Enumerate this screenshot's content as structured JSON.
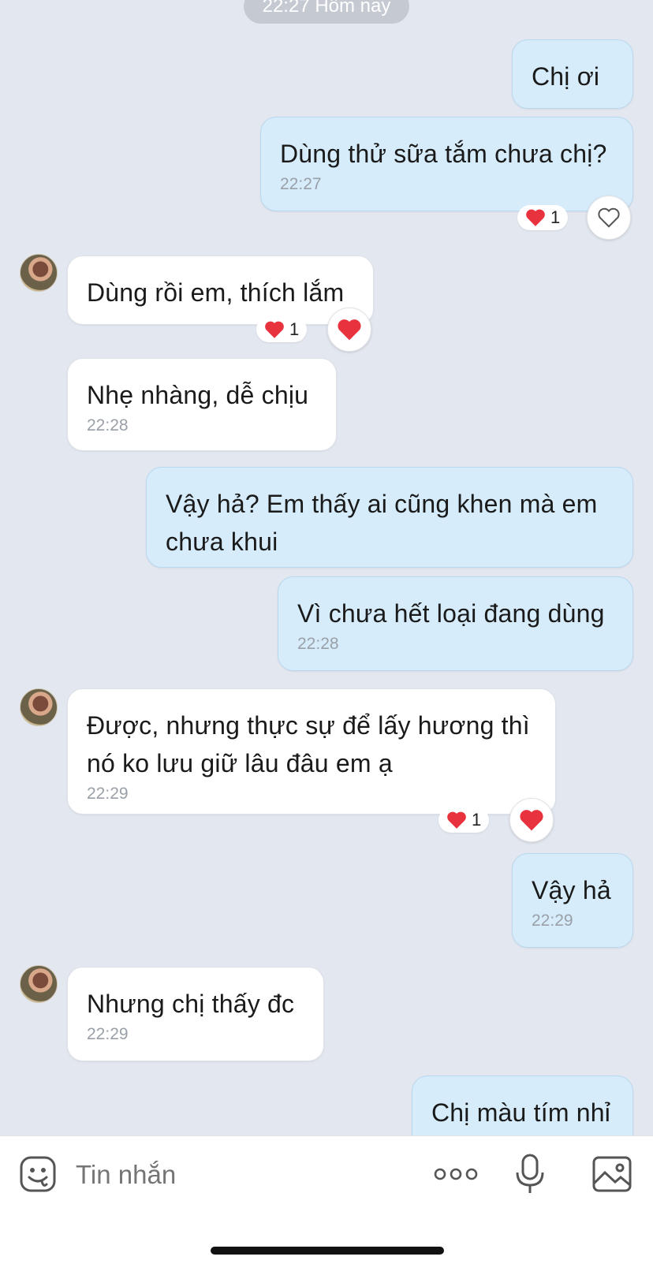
{
  "date_header": "22:27 Hôm nay",
  "messages": [
    {
      "dir": "out",
      "text": "Chị ơi",
      "time": ""
    },
    {
      "dir": "out",
      "text": "Dùng thử sữa tắm chưa chị?",
      "time": "22:27",
      "reaction_count": "1"
    },
    {
      "dir": "in",
      "text": "Dùng rồi em, thích lắm",
      "time": "",
      "reaction_count": "1"
    },
    {
      "dir": "in",
      "text": "Nhẹ nhàng, dễ chịu",
      "time": "22:28"
    },
    {
      "dir": "out",
      "text": "Vậy hả? Em thấy ai cũng khen mà em chưa khui",
      "time": ""
    },
    {
      "dir": "out",
      "text": "Vì chưa hết loại đang dùng",
      "time": "22:28"
    },
    {
      "dir": "in",
      "text": "Được, nhưng thực sự để lấy hương thì nó ko lưu giữ lâu đâu em ạ",
      "time": "22:29",
      "reaction_count": "1"
    },
    {
      "dir": "out",
      "text": "Vậy hả",
      "time": "22:29"
    },
    {
      "dir": "in",
      "text": "Nhưng chị thấy đc",
      "time": "22:29"
    },
    {
      "dir": "out",
      "text": "Chị màu tím nhỉ",
      "time": ""
    }
  ],
  "composer": {
    "placeholder": "Tin nhắn",
    "icons": [
      "sticker-icon",
      "more-icon",
      "microphone-icon",
      "image-icon"
    ]
  },
  "colors": {
    "background": "#e3e7ef",
    "outgoing_bubble": "#d6ecfb",
    "incoming_bubble": "#ffffff",
    "heart": "#e8333f"
  }
}
